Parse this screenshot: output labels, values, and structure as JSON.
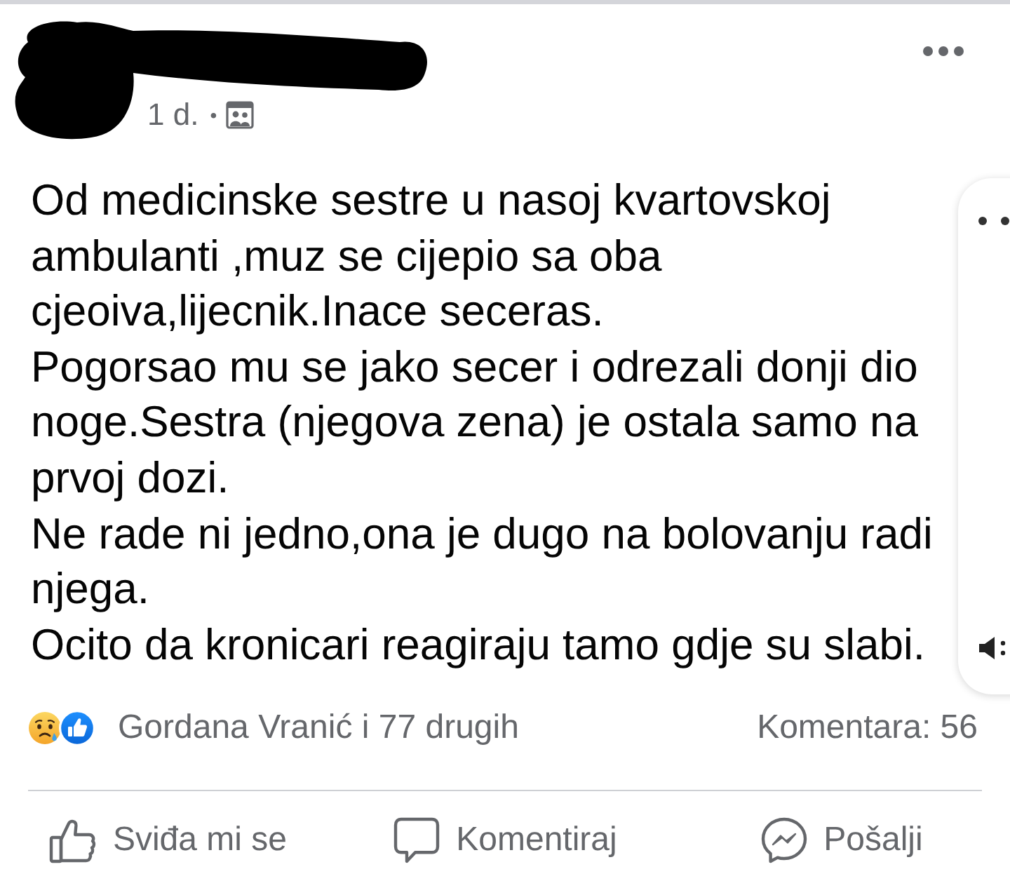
{
  "post_header": {
    "time": "1 d.",
    "separator": "•"
  },
  "post_text": [
    "Od medicinske sestre u nasoj kvartovskoj ambulanti ,muz se cijepio sa oba cjeoiva,lijecnik.Inace seceras.",
    "Pogorsao mu se jako secer i odrezali donji dio noge.Sestra (njegova zena) je ostala samo na prvoj dozi.",
    "Ne rade ni jedno,ona je dugo na bolovanju radi njega.",
    "Ocito da kronicari reagiraju tamo gdje su slabi."
  ],
  "reactions": {
    "summary": "Gordana Vranić i 77 drugih",
    "comments": "Komentara: 56"
  },
  "actions": [
    {
      "kind": "like",
      "label": "Sviđa mi se"
    },
    {
      "kind": "comment",
      "label": "Komentiraj"
    },
    {
      "kind": "share",
      "label": "Pošalji"
    }
  ]
}
